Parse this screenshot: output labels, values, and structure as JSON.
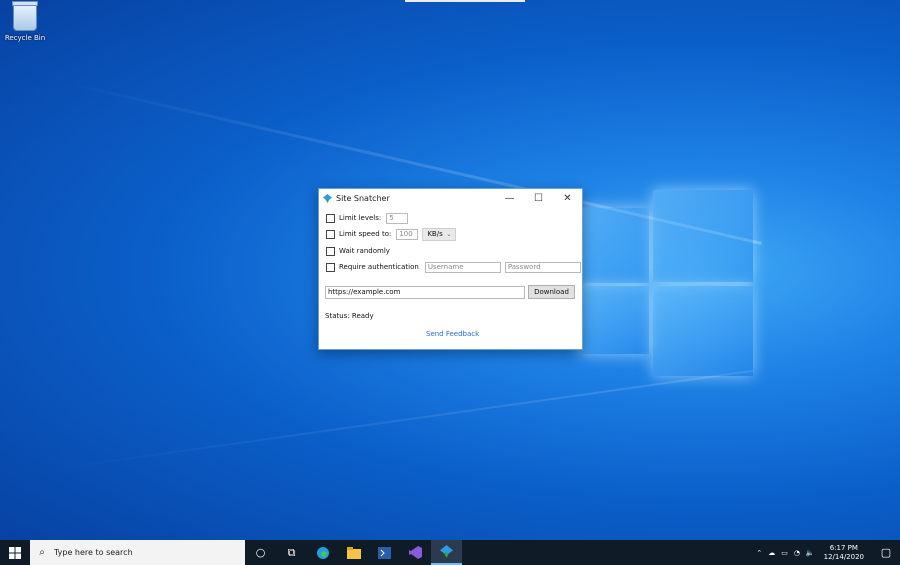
{
  "desktop": {
    "recycle_bin_label": "Recycle Bin"
  },
  "window": {
    "title": "Site Snatcher",
    "controls": {
      "minimize": "—",
      "maximize": "☐",
      "close": "✕"
    },
    "options": {
      "limit_levels": {
        "label": "Limit levels:",
        "checked": false,
        "value": "5"
      },
      "limit_speed": {
        "label": "Limit speed to:",
        "checked": false,
        "value": "100",
        "unit": "KB/s"
      },
      "wait_randomly": {
        "label": "Wait randomly",
        "checked": false
      },
      "require_auth": {
        "label": "Require authentication",
        "checked": false,
        "username_placeholder": "Username",
        "password_placeholder": "Password"
      }
    },
    "url_value": "https://example.com",
    "download_label": "Download",
    "status": "Status: Ready",
    "feedback_link": "Send Feedback"
  },
  "taskbar": {
    "search_placeholder": "Type here to search",
    "time": "6:17 PM",
    "date": "12/14/2020"
  }
}
